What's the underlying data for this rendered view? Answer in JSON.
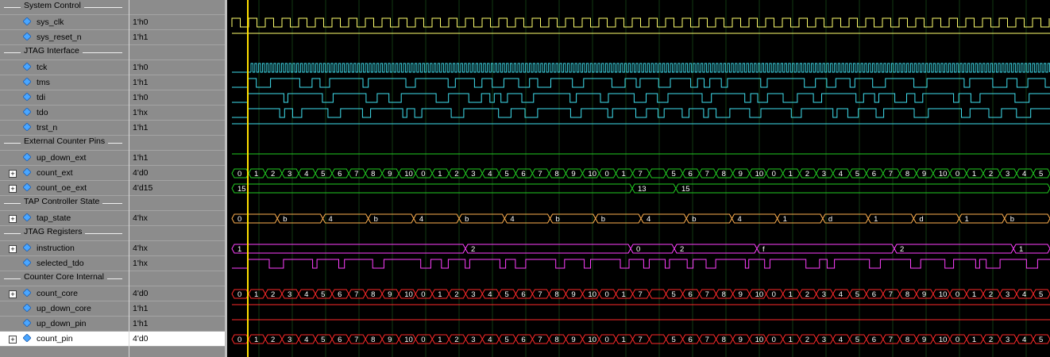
{
  "colors": {
    "clk": "#ffff6e",
    "jtag": "#40e0f0",
    "tap": "#ffb050",
    "instr": "#ff40ff",
    "core": "#ff2a2a",
    "pins": "#22cc22",
    "cursor": "#ffe000"
  },
  "rows": [
    {
      "kind": "group",
      "label": "System Control"
    },
    {
      "kind": "signal",
      "name": "sys_clk",
      "value": "1'h0",
      "color": "clk",
      "wave": "clock"
    },
    {
      "kind": "signal",
      "name": "sys_reset_n",
      "value": "1'h1",
      "color": "clk",
      "wave": "high"
    },
    {
      "kind": "group",
      "label": "JTAG Interface"
    },
    {
      "kind": "signal",
      "name": "tck",
      "value": "1'h0",
      "color": "jtag",
      "wave": "fastclock"
    },
    {
      "kind": "signal",
      "name": "tms",
      "value": "1'h1",
      "color": "jtag",
      "wave": "pulses"
    },
    {
      "kind": "signal",
      "name": "tdi",
      "value": "1'h0",
      "color": "jtag",
      "wave": "pulses"
    },
    {
      "kind": "signal",
      "name": "tdo",
      "value": "1'hx",
      "color": "jtag",
      "wave": "pulses"
    },
    {
      "kind": "signal",
      "name": "trst_n",
      "value": "1'h1",
      "color": "jtag",
      "wave": "high"
    },
    {
      "kind": "group",
      "label": "External Counter Pins"
    },
    {
      "kind": "signal",
      "name": "up_down_ext",
      "value": "1'h1",
      "color": "pins",
      "wave": "high"
    },
    {
      "kind": "signal",
      "name": "count_ext",
      "value": "4'd0",
      "color": "pins",
      "wave": "bus",
      "expand": true
    },
    {
      "kind": "signal",
      "name": "count_oe_ext",
      "value": "4'd15",
      "color": "pins",
      "wave": "bus2",
      "expand": true
    },
    {
      "kind": "group",
      "label": "TAP Controller State"
    },
    {
      "kind": "signal",
      "name": "tap_state",
      "value": "4'hx",
      "color": "tap",
      "wave": "busdense",
      "expand": true
    },
    {
      "kind": "group",
      "label": "JTAG Registers"
    },
    {
      "kind": "signal",
      "name": "instruction",
      "value": "4'hx",
      "color": "instr",
      "wave": "bus3",
      "expand": true
    },
    {
      "kind": "signal",
      "name": "selected_tdo",
      "value": "1'hx",
      "color": "instr",
      "wave": "pulses"
    },
    {
      "kind": "group",
      "label": "Counter Core Internal"
    },
    {
      "kind": "signal",
      "name": "count_core",
      "value": "4'd0",
      "color": "core",
      "wave": "bus",
      "expand": true
    },
    {
      "kind": "signal",
      "name": "up_down_core",
      "value": "1'h1",
      "color": "core",
      "wave": "high"
    },
    {
      "kind": "signal",
      "name": "up_down_pin",
      "value": "1'h1",
      "color": "core",
      "wave": "high"
    },
    {
      "kind": "signal",
      "name": "count_pin",
      "value": "4'd0",
      "color": "core",
      "wave": "bus",
      "expand": true,
      "highlight": true
    }
  ],
  "bus_labels": {
    "count": [
      "0",
      "1",
      "2",
      "3",
      "4",
      "5",
      "6",
      "7",
      "8",
      "9",
      "10",
      "0",
      "1",
      "2",
      "3",
      "4",
      "5",
      "6",
      "7",
      "8",
      "9",
      "10",
      "0",
      "1",
      "7",
      "",
      "5",
      "6",
      "7",
      "8",
      "9",
      "10",
      "0",
      "1",
      "2",
      "3",
      "4",
      "5",
      "6",
      "7",
      "8",
      "9",
      "10",
      "0",
      "1",
      "2",
      "3",
      "4",
      "5"
    ],
    "count_oe": [
      "15",
      "13",
      "15"
    ],
    "instruction": [
      "1",
      "2",
      "0",
      "2",
      "f",
      "2",
      "1"
    ],
    "tap_state": [
      "0",
      "b",
      "4",
      "b",
      "4",
      "b",
      "4",
      "b",
      "b",
      "4",
      "b",
      "4",
      "1",
      "d",
      "1",
      "d",
      "1",
      "b"
    ]
  }
}
